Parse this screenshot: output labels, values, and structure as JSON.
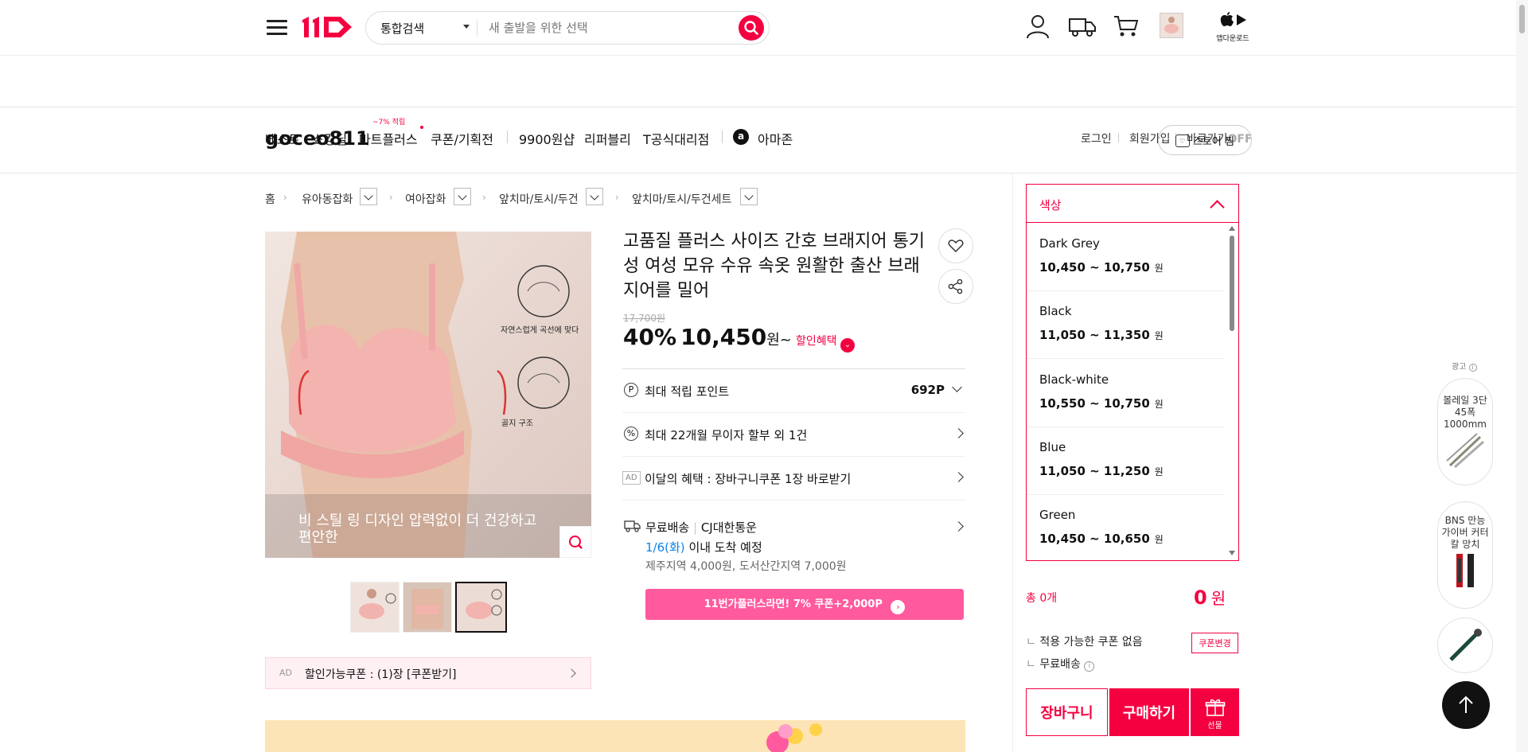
{
  "header": {
    "logo": "11",
    "search_category": "통합검색",
    "search_placeholder": "새 출발을 위한 선택",
    "app_download": "앱다운로드"
  },
  "gnb": {
    "items": [
      "베스트",
      "쇼킹딜",
      "마트플러스",
      "쿠폰/기획전",
      "9900원샵",
      "리퍼블리",
      "T공식대리점",
      "아마존"
    ],
    "mart_badge": "~7% 적립",
    "right": {
      "login": "로그인",
      "signup": "회원가입",
      "shortcut": "바로가기",
      "shortcut_state": "OFF"
    }
  },
  "store": {
    "name": "goceo811",
    "follow_label": "스토어 찜"
  },
  "breadcrumb": [
    "홈",
    "유아동잡화",
    "여아잡화",
    "앞치마/토시/두건",
    "앞치마/토시/두건세트"
  ],
  "gallery": {
    "caption": "비 스틸 링 디자인 압력없이 더 건강하고 편안한",
    "label_top": "자연스럽게 곡선에 맞다",
    "label_bottom": "골지 구조",
    "coupon_ad": "AD",
    "coupon_text": "할인가능쿠폰 : (1)장 [쿠폰받기]"
  },
  "product": {
    "title": "고품질 플러스 사이즈 간호 브래지어 통기성 여성 모유 수유 속옷 원활한 출산 브래지어를 밀어",
    "original_price": "17,700원",
    "discount": "40%",
    "price": "10,450",
    "price_unit": "원~",
    "discount_benefit": "할인혜택",
    "points_label": "최대 적립 포인트",
    "points_value": "692P",
    "installment": "최대 22개월 무이자 할부 외 1건",
    "ad_label": "AD",
    "ad_text": "이달의 혜택 : 장바구니쿠폰 1장 바로받기",
    "shipping_free": "무료배송",
    "carrier": "CJ대한통운",
    "arrival_date": "1/6(화)",
    "arrival_text": "이내 도착 예정",
    "extra_fee": "제주지역 4,000원, 도서산간지역 7,000원",
    "plus_banner": "11번가플러스라면! 7% 쿠폰+2,000P"
  },
  "options": {
    "header": "색상",
    "items": [
      {
        "name": "Dark Grey",
        "price": "10,450 ~ 10,750"
      },
      {
        "name": "Black",
        "price": "11,050 ~ 11,350"
      },
      {
        "name": "Black-white",
        "price": "10,550 ~ 10,750"
      },
      {
        "name": "Blue",
        "price": "11,050 ~ 11,250"
      },
      {
        "name": "Green",
        "price": "10,450 ~ 10,650"
      }
    ],
    "currency": "원"
  },
  "cart": {
    "total_label": "총 0개",
    "total_price": "0",
    "total_unit": "원",
    "coupon_status": "적용 가능한 쿠폰 없음",
    "coupon_change": "쿠폰변경",
    "shipping": "무료배송",
    "cart_button": "장바구니",
    "buy_button": "구매하기",
    "gift_button": "선물"
  },
  "side_ads": {
    "label": "광고",
    "ad1": "볼레일 3단 45폭 1000mm",
    "ad2": "BNS 만능 가이버 커터칼 망치"
  },
  "colors": {
    "brand": "#f40040",
    "price_red": "#ff0038",
    "link_blue": "#0b83e6",
    "plus_pink": "#ff5a9e"
  }
}
